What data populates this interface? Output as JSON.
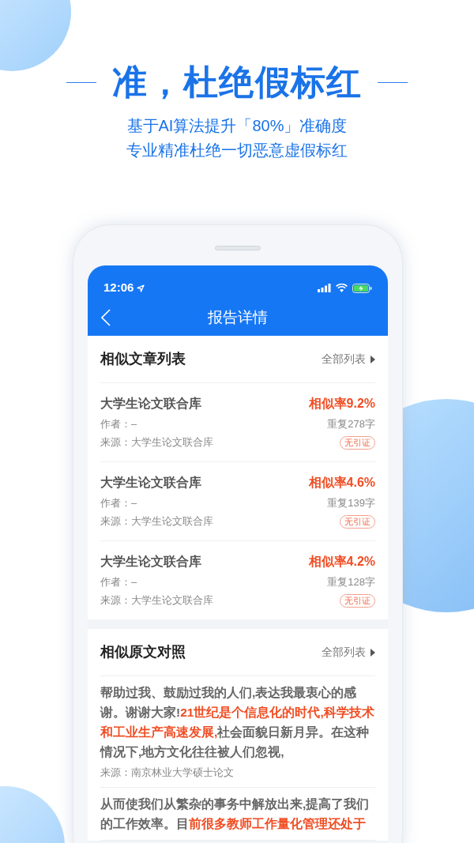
{
  "headline": "准，杜绝假标红",
  "subtitle_lines": [
    "基于AI算法提升「80%」准确度",
    "专业精准杜绝一切恶意虚假标红"
  ],
  "status_bar": {
    "time": "12:06"
  },
  "nav": {
    "title": "报告详情"
  },
  "similar_articles": {
    "title": "相似文章列表",
    "more": "全部列表",
    "items": [
      {
        "name": "大学生论文联合库",
        "rate": "相似率9.2%",
        "author": "作者：–",
        "repeat": "重复278字",
        "source": "来源：大学生论文联合库",
        "tag": "无引证"
      },
      {
        "name": "大学生论文联合库",
        "rate": "相似率4.6%",
        "author": "作者：–",
        "repeat": "重复139字",
        "source": "来源：大学生论文联合库",
        "tag": "无引证"
      },
      {
        "name": "大学生论文联合库",
        "rate": "相似率4.2%",
        "author": "作者：–",
        "repeat": "重复128字",
        "source": "来源：大学生论文联合库",
        "tag": "无引证"
      }
    ]
  },
  "original_comparison": {
    "title": "相似原文对照",
    "more": "全部列表",
    "items": [
      {
        "segments": [
          {
            "text": "帮助过我、鼓励过我的人们,表达我最衷心的感谢。谢谢大家!",
            "highlight": false
          },
          {
            "text": "21世纪是个信息化的时代,科学技术和工业生产高速发展,",
            "highlight": true
          },
          {
            "text": "社会面貌日新月异。在这种情况下,地方文化往往被人们忽视,",
            "highlight": false
          }
        ],
        "source": "来源：南京林业大学硕士论文"
      },
      {
        "segments": [
          {
            "text": "从而使我们从繁杂的事务中解放出来,提高了我们的工作效率。目",
            "highlight": false
          },
          {
            "text": "前很多教师工作量化管理还处于",
            "highlight": true
          }
        ]
      }
    ]
  }
}
